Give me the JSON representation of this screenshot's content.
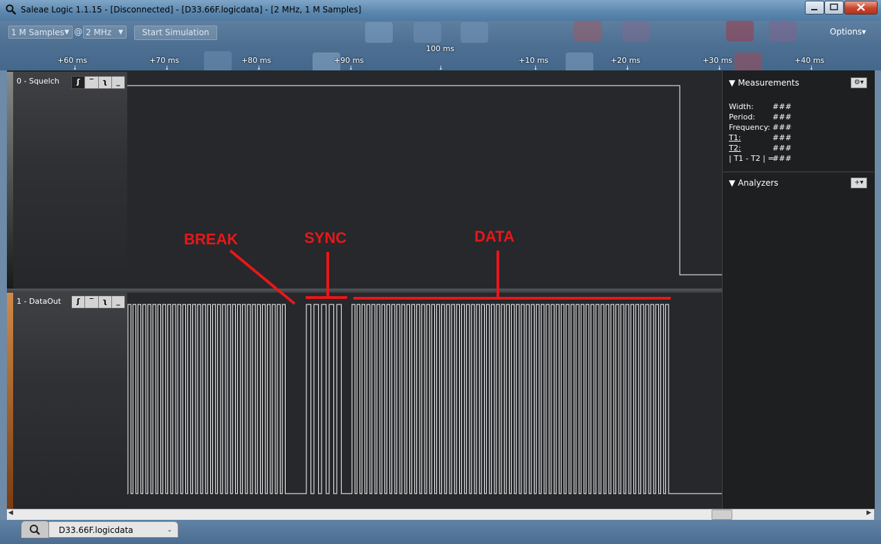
{
  "window": {
    "title": "Saleae Logic 1.1.15 - [Disconnected] - [D33.66F.logicdata] - [2 MHz, 1 M Samples]",
    "icon": "magnifier-icon",
    "minimize_icon": "minimize-icon",
    "maximize_icon": "maximize-icon",
    "close_icon": "close-icon"
  },
  "toolbar": {
    "samples_value": "1 M Samples",
    "at_label": "@",
    "rate_value": "2 MHz",
    "start_label": "Start Simulation",
    "options_label": "Options▾"
  },
  "timeline": {
    "center_label": "100 ms",
    "ticks": [
      "+60 ms",
      "+70 ms",
      "+80 ms",
      "+90 ms",
      "+10 ms",
      "+20 ms",
      "+30 ms",
      "+40 ms"
    ]
  },
  "channels": [
    {
      "name": "0 - Squelch",
      "stripe_color": "#9a9a9a"
    },
    {
      "name": "1 - DataOut",
      "stripe_color": "#b86a28"
    }
  ],
  "trigger_buttons": [
    "rising-edge-icon",
    "high-level-icon",
    "falling-edge-icon",
    "low-level-icon"
  ],
  "measurements": {
    "header": "Measurements",
    "rows": [
      {
        "label": "Width:",
        "value": "###"
      },
      {
        "label": "Period:",
        "value": "###"
      },
      {
        "label": "Frequency:",
        "value": "###"
      },
      {
        "label": "T1:",
        "value": "###"
      },
      {
        "label": "T2:",
        "value": "###"
      },
      {
        "label": "| T1 - T2 | =",
        "value": "###"
      }
    ]
  },
  "analyzers": {
    "header": "Analyzers"
  },
  "annotations": {
    "break": "BREAK",
    "sync": "SYNC",
    "data": "DATA",
    "color": "#e8171a"
  },
  "tabs": {
    "file_tab": "D33.66F.logicdata"
  },
  "colors": {
    "trace": "#ffffff",
    "annotation": "#e8171a",
    "window_frame": "#5b86ad"
  }
}
